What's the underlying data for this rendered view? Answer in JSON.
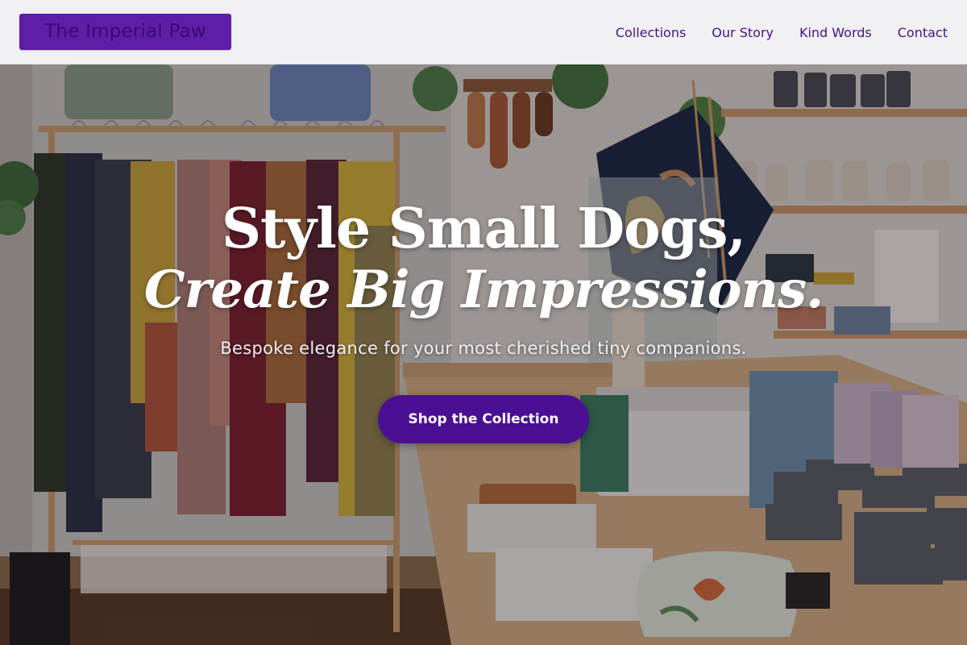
{
  "brand": {
    "name": "The Imperial Paw"
  },
  "nav": {
    "items": [
      {
        "label": "Collections"
      },
      {
        "label": "Our Story"
      },
      {
        "label": "Kind Words"
      },
      {
        "label": "Contact"
      }
    ]
  },
  "hero": {
    "title_line1": "Style Small Dogs,",
    "title_line2": "Create Big Impressions.",
    "subtitle": "Bespoke elegance for your most cherished tiny companions.",
    "cta_label": "Shop the Collection",
    "background_image": "boutique-interior-photo"
  },
  "colors": {
    "brand_purple": "#5e1ea8",
    "nav_text": "#4a0f88",
    "cta_bg": "#4b0f93",
    "hero_text": "#ffffff"
  }
}
